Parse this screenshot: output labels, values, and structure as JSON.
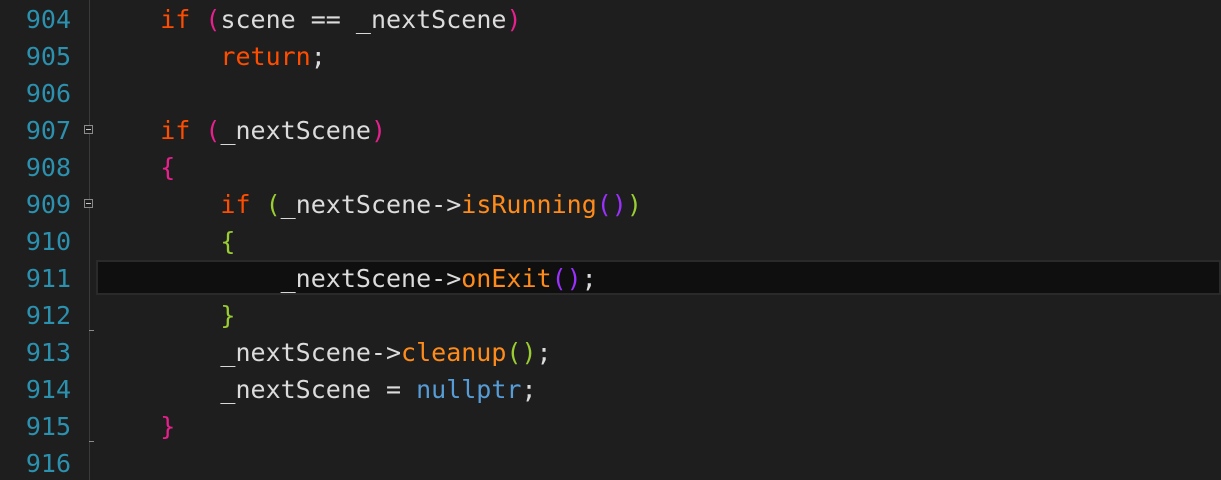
{
  "editor": {
    "lines": [
      {
        "number": "904",
        "indent": "    ",
        "tokens": [
          {
            "t": "if",
            "c": "kw-ctrl"
          },
          {
            "t": " ",
            "c": "txt"
          },
          {
            "t": "(",
            "c": "p1"
          },
          {
            "t": "scene == _nextScene",
            "c": "txt"
          },
          {
            "t": ")",
            "c": "p1"
          }
        ]
      },
      {
        "number": "905",
        "indent": "        ",
        "tokens": [
          {
            "t": "return",
            "c": "kw-ctrl"
          },
          {
            "t": ";",
            "c": "txt"
          }
        ]
      },
      {
        "number": "906",
        "indent": "",
        "tokens": []
      },
      {
        "number": "907",
        "indent": "    ",
        "fold": true,
        "tokens": [
          {
            "t": "if",
            "c": "kw-ctrl"
          },
          {
            "t": " ",
            "c": "txt"
          },
          {
            "t": "(",
            "c": "p1"
          },
          {
            "t": "_nextScene",
            "c": "txt"
          },
          {
            "t": ")",
            "c": "p1"
          }
        ]
      },
      {
        "number": "908",
        "indent": "    ",
        "tokens": [
          {
            "t": "{",
            "c": "p1"
          }
        ]
      },
      {
        "number": "909",
        "indent": "        ",
        "fold": true,
        "tokens": [
          {
            "t": "if",
            "c": "kw-ctrl"
          },
          {
            "t": " ",
            "c": "txt"
          },
          {
            "t": "(",
            "c": "p3"
          },
          {
            "t": "_nextScene->",
            "c": "txt"
          },
          {
            "t": "isRunning",
            "c": "fn"
          },
          {
            "t": "()",
            "c": "p2"
          },
          {
            "t": ")",
            "c": "p3"
          }
        ]
      },
      {
        "number": "910",
        "indent": "        ",
        "tokens": [
          {
            "t": "{",
            "c": "p3"
          }
        ]
      },
      {
        "number": "911",
        "indent": "            ",
        "current": true,
        "tokens": [
          {
            "t": "_nextScene->",
            "c": "txt"
          },
          {
            "t": "onExit",
            "c": "fn"
          },
          {
            "t": "()",
            "c": "p2"
          },
          {
            "t": ";",
            "c": "txt"
          }
        ]
      },
      {
        "number": "912",
        "indent": "        ",
        "foldEnd": true,
        "tokens": [
          {
            "t": "}",
            "c": "p3"
          }
        ]
      },
      {
        "number": "913",
        "indent": "        ",
        "tokens": [
          {
            "t": "_nextScene->",
            "c": "txt"
          },
          {
            "t": "cleanup",
            "c": "fn"
          },
          {
            "t": "()",
            "c": "p3"
          },
          {
            "t": ";",
            "c": "txt"
          }
        ]
      },
      {
        "number": "914",
        "indent": "        ",
        "tokens": [
          {
            "t": "_nextScene = ",
            "c": "txt"
          },
          {
            "t": "nullptr",
            "c": "kw-blue"
          },
          {
            "t": ";",
            "c": "txt"
          }
        ]
      },
      {
        "number": "915",
        "indent": "    ",
        "foldEnd": true,
        "tokens": [
          {
            "t": "}",
            "c": "p1"
          }
        ]
      },
      {
        "number": "916",
        "indent": "",
        "tokens": []
      }
    ]
  },
  "colors": {
    "background": "#1e1e1e",
    "line_number": "#2b91af",
    "control_keyword": "#ff4d00",
    "keyword": "#569cd6",
    "function": "#ff8c1a",
    "bracket_level_1": "#e8208e",
    "bracket_level_2": "#9b30ff",
    "bracket_level_3": "#9acd32",
    "text": "#dcdcdc"
  }
}
